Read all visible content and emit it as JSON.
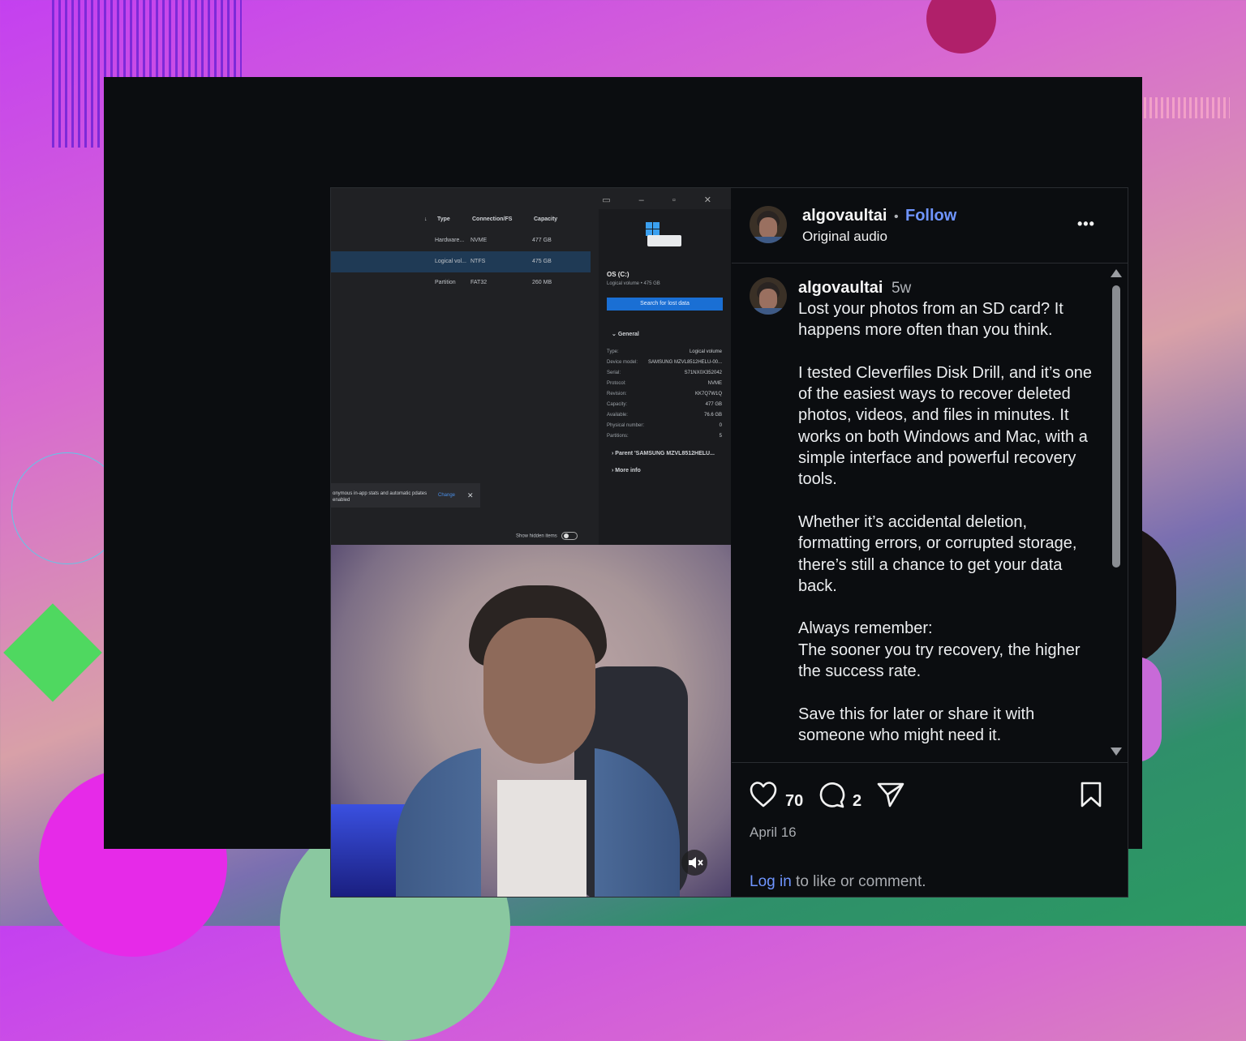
{
  "post": {
    "username": "algovaultai",
    "separator": "•",
    "follow_label": "Follow",
    "audio_label": "Original audio",
    "more_label": "•••",
    "comment_author": "algovaultai",
    "comment_age": "5w",
    "caption": "Lost your photos from an SD card? It happens more often than you think.\n\nI tested Cleverfiles Disk Drill, and it’s one of the easiest ways to recover deleted photos, videos, and files in minutes. It works on both Windows and Mac, with a simple interface and powerful recovery tools.\n\nWhether it’s accidental deletion, formatting errors, or corrupted storage, there’s still a chance to get your data back.\n\nAlways remember:\nThe sooner you try recovery, the higher the success rate.\n\nSave this for later or share it with someone who might need it.",
    "likes": "70",
    "comments": "2",
    "date": "April 16",
    "login_link": "Log in",
    "login_suffix": " to like or comment."
  },
  "video_screen": {
    "columns": [
      "Type",
      "Connection/FS",
      "Capacity"
    ],
    "rows": [
      {
        "type": "Hardware...",
        "conn": "NVME",
        "cap": "477 GB"
      },
      {
        "type": "Logical vol...",
        "conn": "NTFS",
        "cap": "475 GB"
      },
      {
        "type": "Partition",
        "conn": "FAT32",
        "cap": "260 MB"
      }
    ],
    "drive_name": "OS (C:)",
    "drive_sub": "Logical volume • 475 GB",
    "search_button": "Search for lost data",
    "section_general": "General",
    "details": [
      {
        "k": "Type:",
        "v": "Logical volume"
      },
      {
        "k": "Device model:",
        "v": "SAMSUNG MZVL8512HELU-00..."
      },
      {
        "k": "Serial:",
        "v": "S71NX0X352042"
      },
      {
        "k": "Protocol:",
        "v": "NVME"
      },
      {
        "k": "Revision:",
        "v": "KK7Q7W1Q"
      },
      {
        "k": "Capacity:",
        "v": "477 GB"
      },
      {
        "k": "Available:",
        "v": "76.6 GB"
      },
      {
        "k": "Physical number:",
        "v": "0"
      },
      {
        "k": "Partitions:",
        "v": "5"
      }
    ],
    "parent_label": "Parent 'SAMSUNG MZVL8512HELU...",
    "more_info": "More info",
    "notice_text": "onymous in-app stats and automatic pdates enabled",
    "notice_change": "Change",
    "show_hidden": "Show hidden items"
  },
  "colors": {
    "accent": "#5b8cff",
    "link": "#6f95ff",
    "background": "#0b0d10"
  }
}
